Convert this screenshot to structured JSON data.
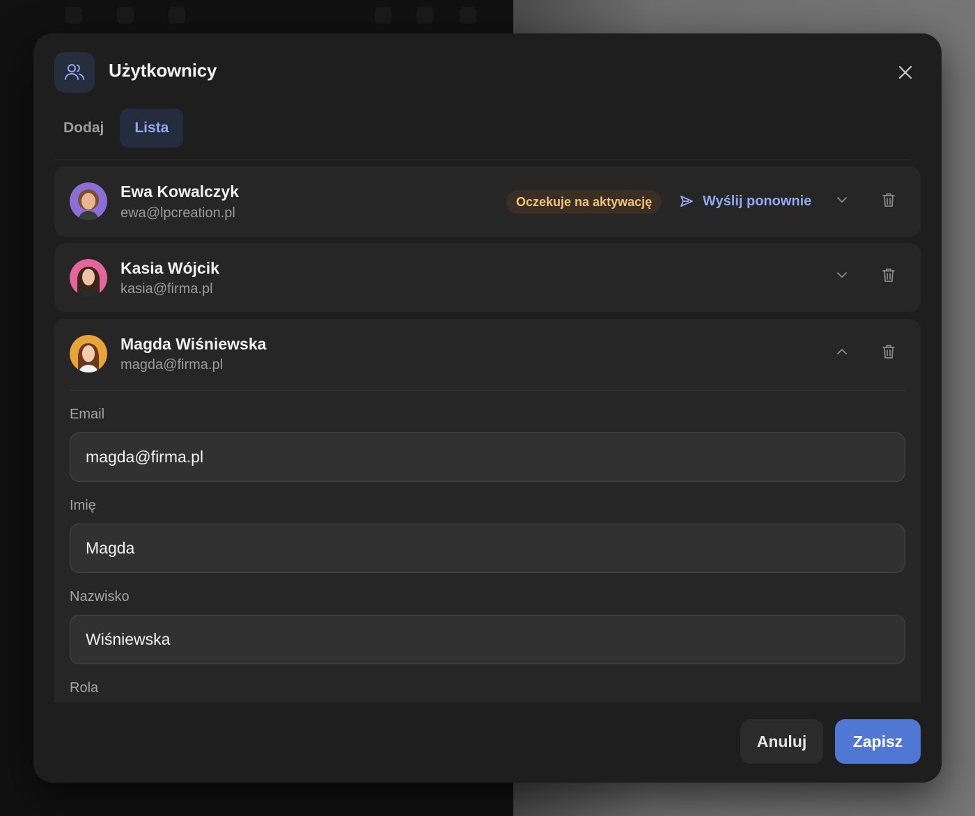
{
  "modal": {
    "title": "Użytkownicy",
    "icon": "users-icon",
    "close_icon": "close-icon"
  },
  "tabs": [
    {
      "label": "Dodaj",
      "active": false
    },
    {
      "label": "Lista",
      "active": true
    }
  ],
  "users": [
    {
      "name": "Ewa Kowalczyk",
      "email": "ewa@lpcreation.pl",
      "status": "Oczekuje na aktywację",
      "resend_label": "Wyślij ponownie",
      "expanded": false,
      "avatar_color": "#8b6fd6"
    },
    {
      "name": "Kasia Wójcik",
      "email": "kasia@firma.pl",
      "expanded": false,
      "avatar_color": "#e2669a"
    },
    {
      "name": "Magda Wiśniewska",
      "email": "magda@firma.pl",
      "expanded": true,
      "avatar_color": "#e8a33c"
    }
  ],
  "edit_form": {
    "email_label": "Email",
    "email_value": "magda@firma.pl",
    "first_name_label": "Imię",
    "first_name_value": "Magda",
    "last_name_label": "Nazwisko",
    "last_name_value": "Wiśniewska",
    "role_label": "Rola"
  },
  "footer": {
    "cancel_label": "Anuluj",
    "save_label": "Zapisz"
  },
  "colors": {
    "accent": "#4f77d3",
    "tab_active": "#8fa9ef",
    "badge_bg": "#3a2f22",
    "badge_text": "#f2c27a"
  }
}
